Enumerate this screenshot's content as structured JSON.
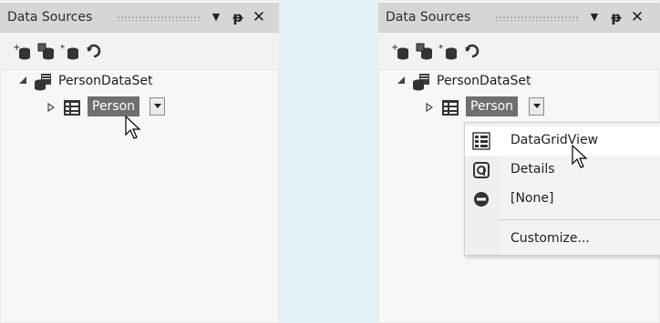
{
  "left_panel": {
    "title": "Data Sources",
    "tree": {
      "root_label": "PersonDataSet",
      "child_label": "Person"
    }
  },
  "right_panel": {
    "title": "Data Sources",
    "tree": {
      "root_label": "PersonDataSet",
      "child_label": "Person"
    },
    "context_menu": {
      "items": [
        {
          "label": "DataGridView",
          "icon": "datagrid-icon",
          "highlighted": true
        },
        {
          "label": "Details",
          "icon": "details-icon"
        },
        {
          "label": "[None]",
          "icon": "none-icon"
        }
      ],
      "customize_label": "Customize..."
    }
  },
  "titlebar_icons": [
    "dropdown-arrow-icon",
    "pin-icon",
    "close-icon"
  ],
  "toolbar_icons": [
    "add-data-source-icon",
    "edit-dataset-designer-icon",
    "configure-dataset-icon",
    "refresh-icon"
  ],
  "colors": {
    "background": "#e4f0f8",
    "panel": "#f7f7f7",
    "titlebar": "#d6d6d6",
    "selection": "#6f6f6f",
    "menu_highlight": "#ffffff"
  }
}
